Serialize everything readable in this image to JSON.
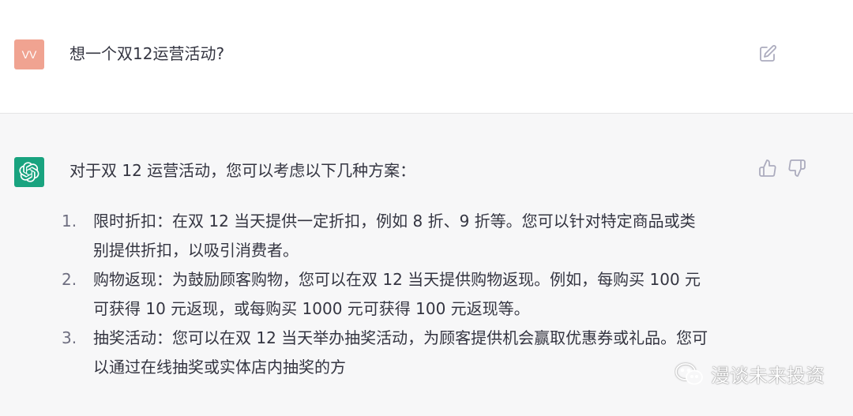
{
  "user_message": {
    "avatar_initials": "VV",
    "text": "想一个双12运营活动?"
  },
  "assistant_message": {
    "intro": "对于双 12 运营活动，您可以考虑以下几种方案：",
    "items": [
      {
        "number": "1.",
        "lines": [
          "限时折扣：在双 12 当天提供一定折扣，例如 8 折、9 折等。您可以针对特定商品或类",
          "别提供折扣，以吸引消费者。"
        ]
      },
      {
        "number": "2.",
        "lines": [
          "购物返现：为鼓励顾客购物，您可以在双 12 当天提供购物返现。例如，每购买 100 元",
          "可获得 10 元返现，或每购买 1000 元可获得 100 元返现等。"
        ]
      },
      {
        "number": "3.",
        "lines": [
          "抽奖活动：您可以在双 12 当天举办抽奖活动，为顾客提供机会赢取优惠券或礼品。您可",
          "以通过在线抽奖或实体店内抽奖的方"
        ]
      }
    ]
  },
  "watermark": {
    "text": "漫谈未来投资"
  },
  "icons": {
    "edit": "edit-icon",
    "thumbs_up": "thumbs-up-icon",
    "thumbs_down": "thumbs-down-icon",
    "assistant_logo": "openai-logo-icon",
    "wechat": "wechat-icon"
  },
  "colors": {
    "user_avatar": "#f0a391",
    "assistant_avatar": "#19a37f",
    "assistant_bg": "#f7f7f8",
    "text": "#343541"
  }
}
